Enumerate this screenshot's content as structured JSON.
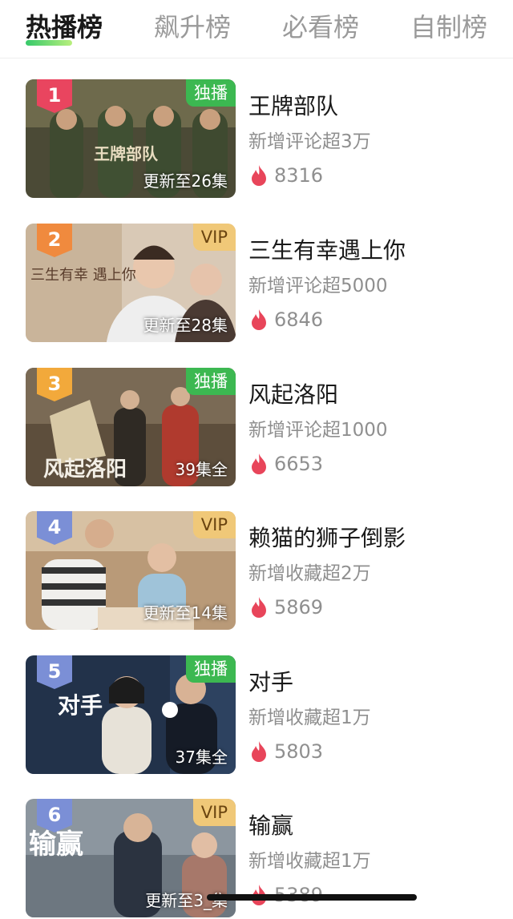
{
  "tabs": [
    {
      "label": "热播榜",
      "active": true
    },
    {
      "label": "飙升榜",
      "active": false
    },
    {
      "label": "必看榜",
      "active": false
    },
    {
      "label": "自制榜",
      "active": false
    }
  ],
  "colors": {
    "accent_green": "#3cb851",
    "vip_gold": "#f0c878",
    "heat_red": "#e8455a",
    "rank_1": "#e9455f",
    "rank_2": "#f08a3e",
    "rank_3": "#f2a93b",
    "rank_other": "#7b8fd6"
  },
  "items": [
    {
      "rank": "1",
      "badge": "独播",
      "badge_type": "exclusive",
      "episodes": "更新至26集",
      "poster_text": "王牌部队",
      "title": "王牌部队",
      "subtitle": "新增评论超3万",
      "heat": "8316"
    },
    {
      "rank": "2",
      "badge": "VIP",
      "badge_type": "vip",
      "episodes": "更新至28集",
      "poster_text": "三生有幸 遇上你",
      "title": "三生有幸遇上你",
      "subtitle": "新增评论超5000",
      "heat": "6846"
    },
    {
      "rank": "3",
      "badge": "独播",
      "badge_type": "exclusive",
      "episodes": "39集全",
      "poster_text": "风起洛阳",
      "title": "风起洛阳",
      "subtitle": "新增评论超1000",
      "heat": "6653"
    },
    {
      "rank": "4",
      "badge": "VIP",
      "badge_type": "vip",
      "episodes": "更新至14集",
      "poster_text": "",
      "title": "赖猫的狮子倒影",
      "subtitle": "新增收藏超2万",
      "heat": "5869"
    },
    {
      "rank": "5",
      "badge": "独播",
      "badge_type": "exclusive",
      "episodes": "37集全",
      "poster_text": "对手",
      "title": "对手",
      "subtitle": "新增收藏超1万",
      "heat": "5803"
    },
    {
      "rank": "6",
      "badge": "VIP",
      "badge_type": "vip",
      "episodes": "更新至3_集",
      "poster_text": "输赢",
      "title": "输赢",
      "subtitle": "新增收藏超1万",
      "heat": "5389"
    }
  ]
}
